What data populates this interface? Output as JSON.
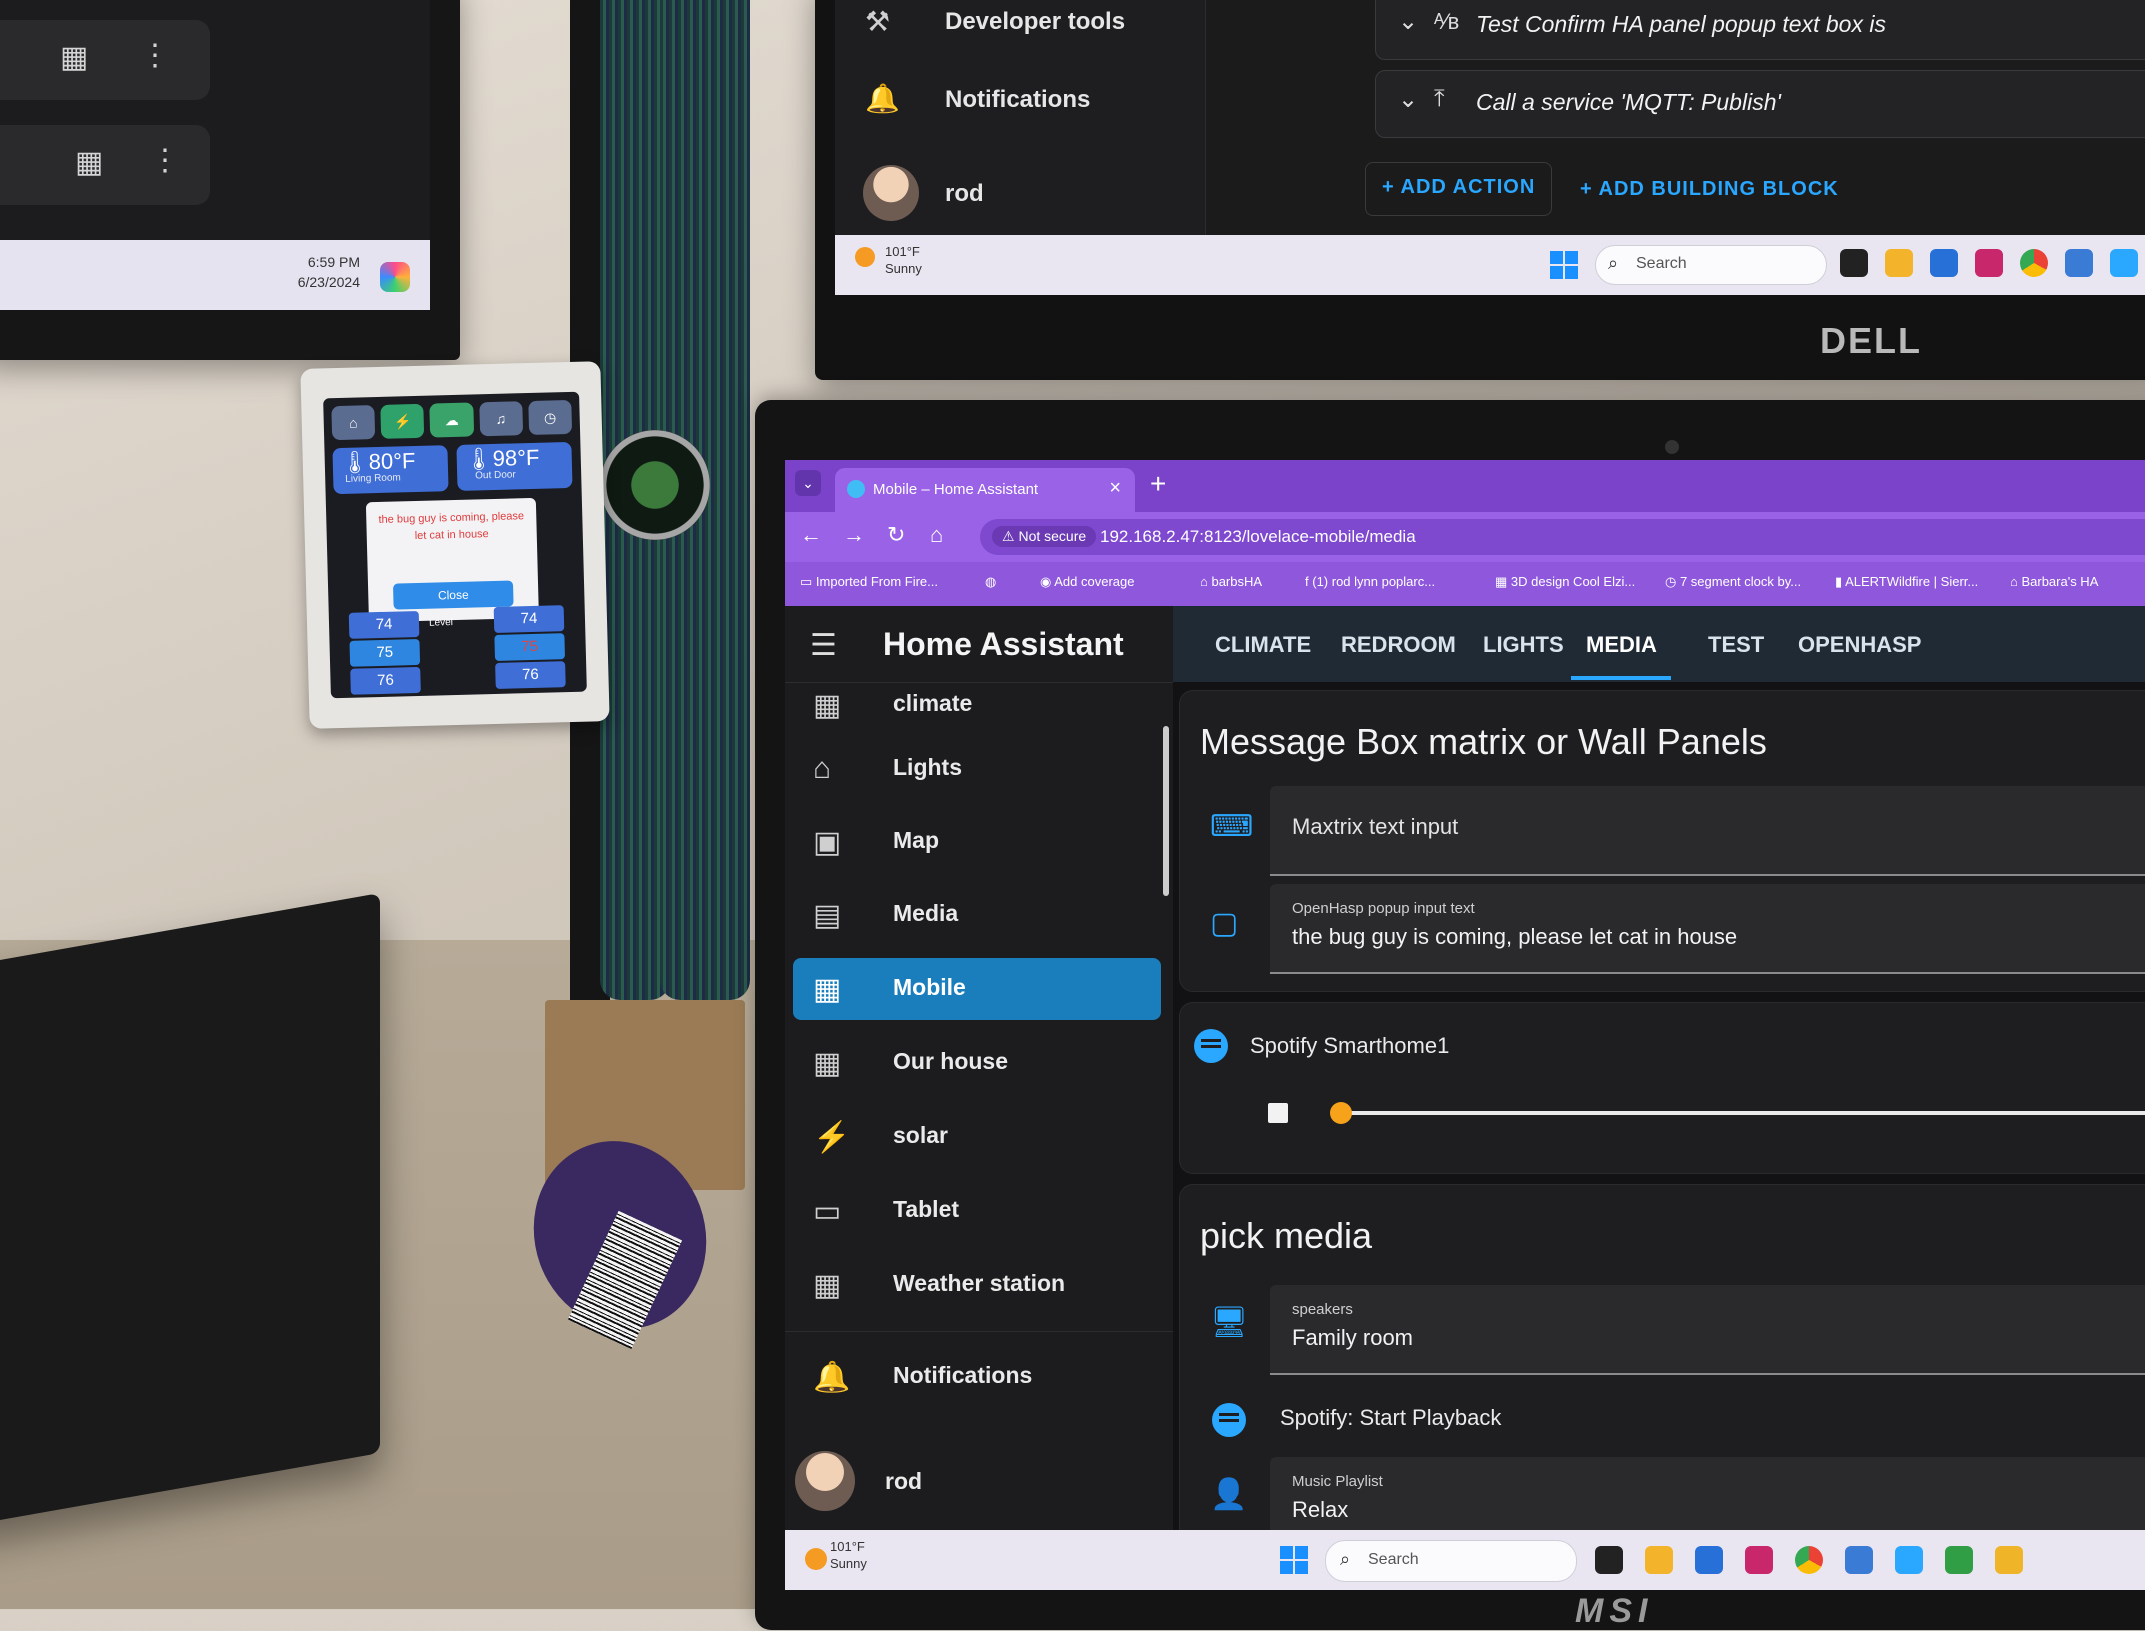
{
  "top_left_monitor": {
    "time": "6:59 PM",
    "date": "6/23/2024"
  },
  "top_right_monitor": {
    "sidebar": {
      "developer_tools": "Developer tools",
      "notifications": "Notifications",
      "user": "rod"
    },
    "actions": [
      {
        "label": "Test Confirm HA panel popup text box is"
      },
      {
        "label": "Call a service 'MQTT: Publish'"
      }
    ],
    "add_action": "ADD ACTION",
    "add_building_block": "ADD BUILDING BLOCK",
    "taskbar": {
      "temp": "101°F",
      "condition": "Sunny",
      "search": "Search"
    },
    "brand": "DELL"
  },
  "wall_panel": {
    "temp1": "80°F",
    "temp1_label": "Living Room",
    "temp2": "98°F",
    "temp2_label": "Out Door",
    "popup_message": "the bug guy is coming, please let cat in house",
    "close_button": "Close",
    "values": [
      "74",
      "75",
      "76",
      "74",
      "75",
      "76"
    ],
    "level_label": "Level"
  },
  "browser": {
    "tab_title": "Mobile – Home Assistant",
    "not_secure": "Not secure",
    "url": "192.168.2.47:8123/lovelace-mobile/media",
    "bookmarks": [
      "Imported From Fire...",
      "Add coverage",
      "barbsHA",
      "(1) rod lynn poplarc...",
      "3D design Cool Elzi...",
      "7 segment clock by...",
      "ALERTWildfire | Sierr...",
      "Barbara's HA"
    ]
  },
  "home_assistant": {
    "title": "Home Assistant",
    "sidebar": [
      {
        "label": "climate",
        "icon": "dashboard-icon"
      },
      {
        "label": "Lights",
        "icon": "home-icon"
      },
      {
        "label": "Map",
        "icon": "map-icon"
      },
      {
        "label": "Media",
        "icon": "media-icon"
      },
      {
        "label": "Mobile",
        "icon": "dashboard-icon",
        "active": true
      },
      {
        "label": "Our house",
        "icon": "dashboard-icon"
      },
      {
        "label": "solar",
        "icon": "solar-icon"
      },
      {
        "label": "Tablet",
        "icon": "tablet-icon"
      },
      {
        "label": "Weather station",
        "icon": "dashboard-icon"
      }
    ],
    "notifications": "Notifications",
    "user": "rod",
    "tabs": [
      "CLIMATE",
      "REDROOM",
      "LIGHTS",
      "MEDIA",
      "TEST",
      "OPENHASP"
    ],
    "active_tab": "MEDIA",
    "card1": {
      "title": "Message Box matrix or Wall Panels",
      "matrix_input_placeholder": "Maxtrix text input",
      "openhasp_label": "OpenHasp popup input text",
      "openhasp_value": "the bug guy is coming, please let cat in house"
    },
    "spotify": {
      "name": "Spotify Smarthome1"
    },
    "card2": {
      "title": "pick media",
      "speakers_label": "speakers",
      "speakers_value": "Family room",
      "start_playback": "Spotify: Start Playback",
      "playlist_label": "Music Playlist",
      "playlist_value": "Relax"
    }
  },
  "laptop_taskbar": {
    "temp": "101°F",
    "condition": "Sunny",
    "search": "Search"
  },
  "laptop_brand": "MSI",
  "colors": {
    "accent": "#2aa7ff",
    "browser_purple": "#9a62e6",
    "active_sidebar": "#1a7ebc",
    "slider_knob": "#f7a21b"
  }
}
